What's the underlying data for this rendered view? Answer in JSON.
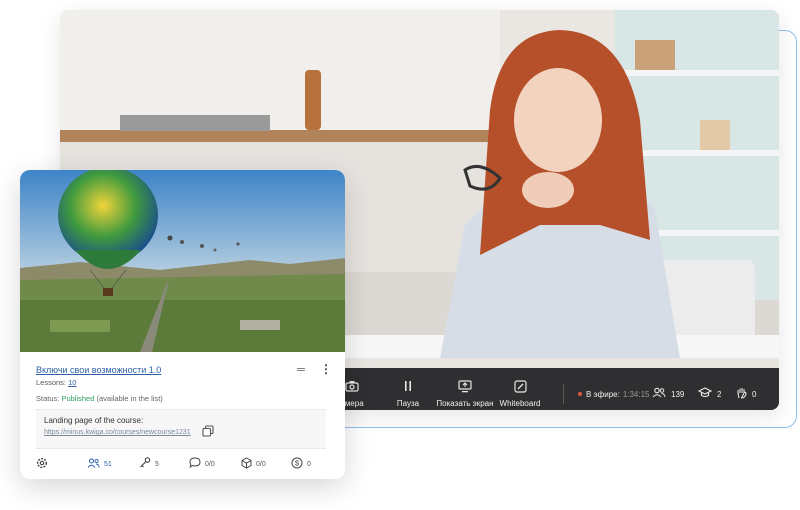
{
  "video": {
    "controls": [
      {
        "label": "амера",
        "icon": "camera-icon"
      },
      {
        "label": "Пауза",
        "icon": "pause-icon"
      },
      {
        "label": "Показать экран",
        "icon": "share-screen-icon"
      },
      {
        "label": "Whiteboard",
        "icon": "whiteboard-icon"
      }
    ],
    "live_label": "В эфире:",
    "live_time": "1:34:15",
    "participants_count": "139",
    "students_count": "2",
    "hands_count": "0"
  },
  "course_card": {
    "title": "Включи свои возможности 1.0",
    "lessons_label": "Lessons:",
    "lessons_count": "10",
    "status_label": "Status:",
    "status_value": "Published",
    "status_note": "(available in the list)",
    "landing_title": "Landing page of the course:",
    "landing_url": "https://minus.kwiga.co/courses/newcourse1231",
    "footer": {
      "users": "51",
      "keys": "5",
      "comments": "0/0",
      "quizzes": "0/0",
      "payments": "0"
    }
  },
  "colors": {
    "accent": "#2c5fa8",
    "published": "#2e9e5b",
    "live_dot": "#e25a3c",
    "control_bar": "#2f2f31"
  }
}
